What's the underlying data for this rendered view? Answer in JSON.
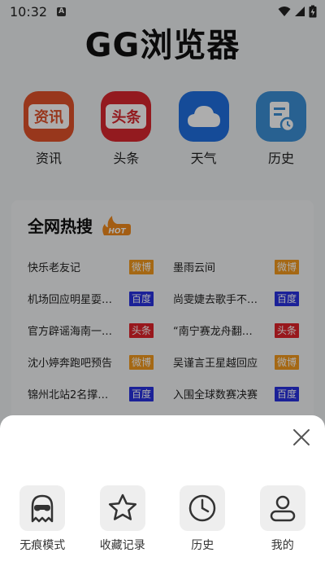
{
  "status_bar": {
    "time": "10:32",
    "notification_icon": "a-letter-icon",
    "icons": [
      "wifi-icon",
      "signal-icon",
      "battery-charging-icon"
    ]
  },
  "page": {
    "title": "GG浏览器"
  },
  "quick_apps": [
    {
      "label": "资讯",
      "icon_text": "资讯",
      "icon": "news-icon",
      "color": "#e0522a"
    },
    {
      "label": "头条",
      "icon_text": "头条",
      "icon": "headline-icon",
      "color": "#d9272e"
    },
    {
      "label": "天气",
      "icon": "cloud-icon",
      "color": "#1f6fe0"
    },
    {
      "label": "历史",
      "icon": "history-document-icon",
      "color": "#3b8fd6"
    }
  ],
  "hot_search": {
    "title": "全网热搜",
    "badge": "HOT",
    "rows": [
      [
        {
          "text": "快乐老友记",
          "tag": "微博"
        },
        {
          "text": "墨雨云间",
          "tag": "微博"
        }
      ],
      [
        {
          "text": "机场回应明星耍大牌",
          "tag": "百度"
        },
        {
          "text": "尚雯婕去歌手不是为了",
          "tag": "百度"
        }
      ],
      [
        {
          "text": "官方辟谣海南一男子",
          "tag": "头条"
        },
        {
          "text": "“南宁赛龙舟翻船事件”",
          "tag": "头条"
        }
      ],
      [
        {
          "text": "沈小婷奔跑吧预告",
          "tag": "微博"
        },
        {
          "text": "吴谨言王星越回应",
          "tag": "微博"
        }
      ],
      [
        {
          "text": "锦州北站2名撑伞男子",
          "tag": "百度"
        },
        {
          "text": "入围全球数赛决赛",
          "tag": "百度"
        }
      ]
    ],
    "tag_colors": {
      "微博": "#f39a1e",
      "百度": "#2932e1",
      "头条": "#e0222a"
    }
  },
  "bottom_sheet": {
    "close_icon": "close-icon",
    "items": [
      {
        "label": "无痕模式",
        "icon": "incognito-ghost-icon"
      },
      {
        "label": "收藏记录",
        "icon": "star-icon"
      },
      {
        "label": "历史",
        "icon": "clock-icon"
      },
      {
        "label": "我的",
        "icon": "user-icon"
      }
    ]
  }
}
